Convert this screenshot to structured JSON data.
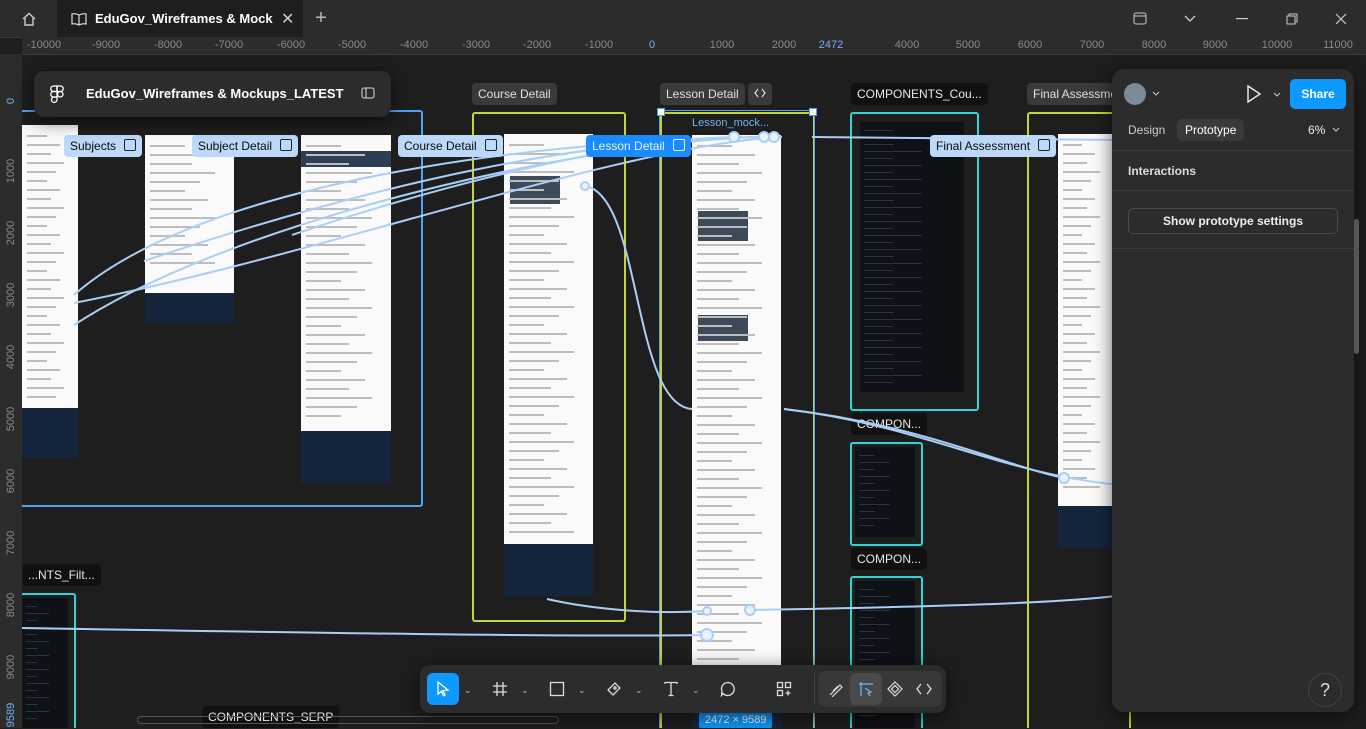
{
  "titlebar": {
    "tab_title": "EduGov_Wireframes & Mockups_LATEST",
    "tab_title_display": "EduGov_Wireframes & Mockups_l"
  },
  "ruler": {
    "h_ticks": [
      "-10000",
      "-9000",
      "-8000",
      "-7000",
      "-6000",
      "-5000",
      "-4000",
      "-3000",
      "-2000",
      "-1000",
      "0",
      "1000",
      "2000",
      "2472",
      "4000",
      "5000",
      "6000",
      "7000",
      "8000",
      "9000",
      "10000",
      "11000"
    ],
    "v_ticks": [
      "0",
      "1000",
      "2000",
      "3000",
      "4000",
      "5000",
      "6000",
      "7000",
      "8000",
      "9000",
      "9589"
    ]
  },
  "file": {
    "name": "EduGov_Wireframes & Mockups_LATEST"
  },
  "frames": {
    "course_detail": "Course Detail",
    "lesson_detail": "Lesson Detail",
    "components_cou": "COMPONENTS_Cou...",
    "final_assessment_top": "Final Assessme...",
    "lesson_mock": "Lesson_mock...",
    "components_2": "COMPON...",
    "components_3": "COMPON...",
    "components_filt": "...NTS_Filt...",
    "components_serp": "COMPONENTS_SERP"
  },
  "flows": {
    "subjects": "Subjects",
    "subject_detail": "Subject Detail",
    "course_detail": "Course Detail",
    "lesson_detail": "Lesson Detail",
    "final_assessment": "Final Assessment"
  },
  "selection": {
    "size": "2472 × 9589"
  },
  "panel": {
    "tabs": [
      "Design",
      "Prototype"
    ],
    "active_tab": "Prototype",
    "zoom": "6%",
    "share_label": "Share",
    "interactions_title": "Interactions",
    "show_settings_label": "Show prototype settings"
  },
  "toolbar": {
    "tools": [
      "move-tool",
      "frame-tool",
      "shape-tool",
      "pen-tool",
      "text-tool",
      "comment-tool",
      "actions-tool",
      "draw-mode",
      "design-mode",
      "prototype-mode",
      "dev-mode"
    ]
  },
  "help": {
    "label": "?"
  },
  "colors": {
    "accent": "#0d99ff",
    "section_border": "#c5d62e",
    "component_border": "#2fd5d5",
    "flow_label": "#bcd9f9",
    "flow_line": "#a9cff7"
  }
}
